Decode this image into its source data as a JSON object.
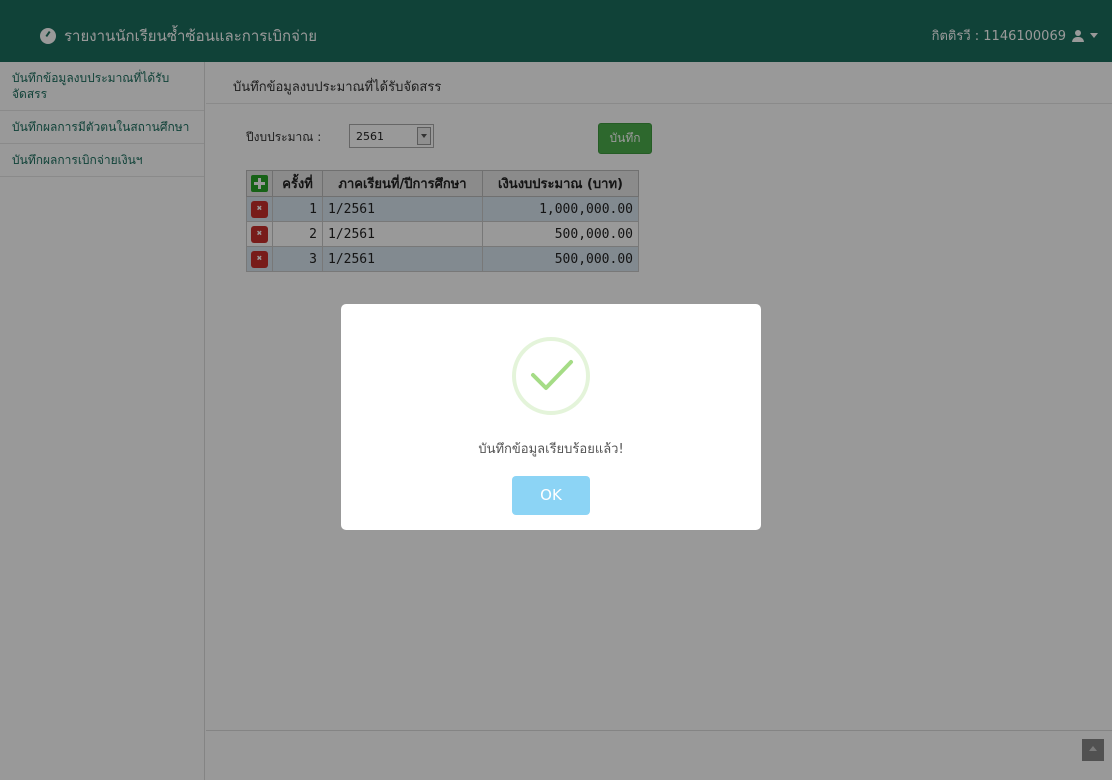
{
  "header": {
    "title": "รายงานนักเรียนซ้ำซ้อนและการเบิกจ่าย",
    "user": "กิตติรวี : 1146100069"
  },
  "sidebar": {
    "items": [
      {
        "label": "บันทึกข้อมูลงบประมาณที่ได้รับจัดสรร"
      },
      {
        "label": "บันทึกผลการมีตัวตนในสถานศึกษา"
      },
      {
        "label": "บันทึกผลการเบิกจ่ายเงินฯ"
      }
    ]
  },
  "main": {
    "page_title": "บันทึกข้อมูลงบประมาณที่ได้รับจัดสรร",
    "year_label": "ปีงบประมาณ :",
    "year_value": "2561",
    "save_label": "บันทึก",
    "table": {
      "headers": [
        "ครั้งที่",
        "ภาคเรียนที่/ปีการศึกษา",
        "เงินงบประมาณ (บาท)"
      ],
      "rows": [
        {
          "no": "1",
          "term": "1/2561",
          "amount": "1,000,000.00"
        },
        {
          "no": "2",
          "term": "1/2561",
          "amount": "500,000.00"
        },
        {
          "no": "3",
          "term": "1/2561",
          "amount": "500,000.00"
        }
      ]
    }
  },
  "modal": {
    "message": "บันทึกข้อมูลเรียบร้อยแล้ว!",
    "ok_label": "OK"
  },
  "colors": {
    "navbar": "#1b6e5e",
    "save_button": "#4cae4c",
    "ok_button": "#8cd4f5",
    "success_check": "#a5dc86"
  },
  "icons": {
    "brand": "dashboard-icon",
    "user": "user-icon",
    "add": "plus-icon",
    "delete": "close-icon"
  }
}
